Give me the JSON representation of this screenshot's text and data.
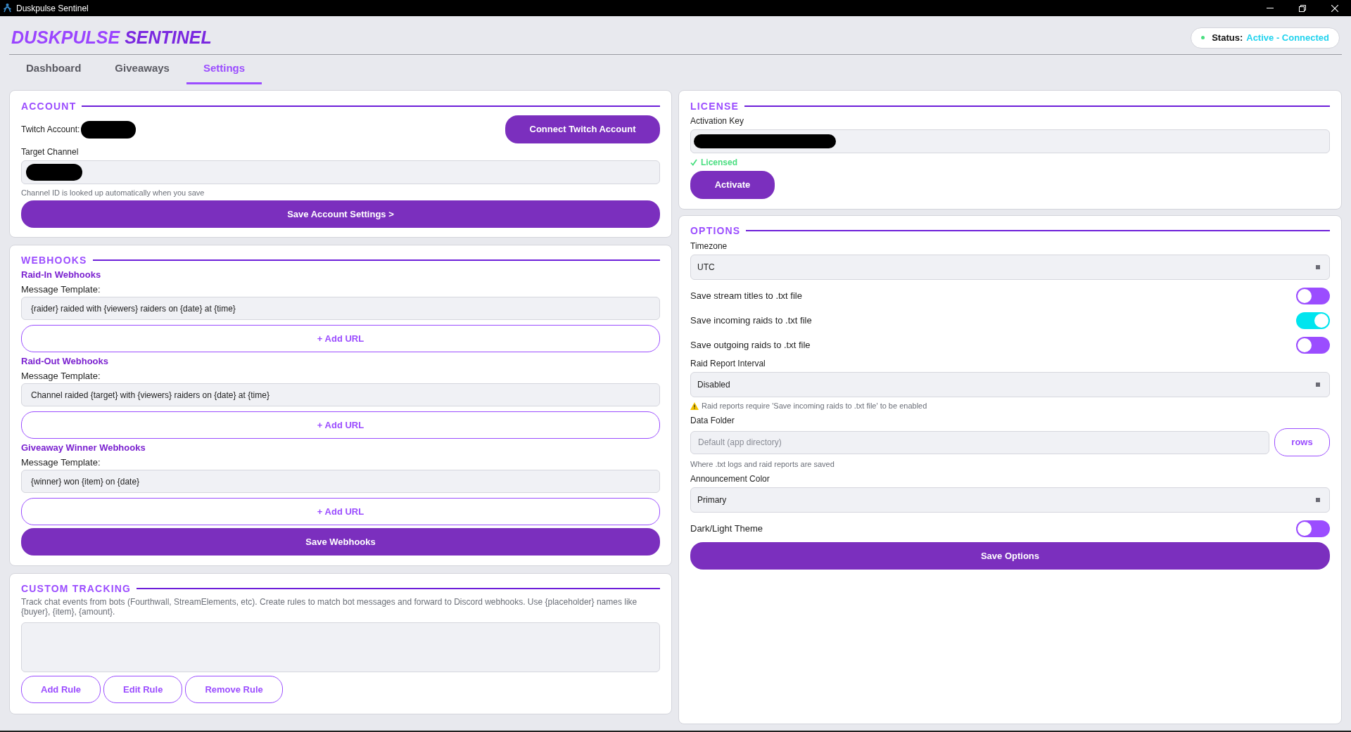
{
  "window": {
    "title": "Duskpulse Sentinel"
  },
  "brand": {
    "first": "DUSKPULSE",
    "second": "SENTINEL"
  },
  "status": {
    "label": "Status:",
    "value": "Active - Connected"
  },
  "tabs": [
    {
      "label": "Dashboard",
      "selected": false
    },
    {
      "label": "Giveaways",
      "selected": false
    },
    {
      "label": "Settings",
      "selected": true
    }
  ],
  "account": {
    "title": "ACCOUNT",
    "twitch_account_label": "Twitch Account:",
    "connect_button": "Connect Twitch Account",
    "target_channel_label": "Target Channel",
    "hint": "Channel ID is looked up automatically when you save",
    "save_button": "Save Account Settings >"
  },
  "webhooks": {
    "title": "WEBHOOKS",
    "groups": [
      {
        "title": "Raid-In Webhooks",
        "template_label": "Message Template:",
        "template": "{raider} raided with {viewers} raiders on {date} at {time}",
        "add_button": "+ Add URL"
      },
      {
        "title": "Raid-Out Webhooks",
        "template_label": "Message Template:",
        "template": "Channel raided {target} with {viewers} raiders on {date} at {time}",
        "add_button": "+ Add URL"
      },
      {
        "title": "Giveaway Winner Webhooks",
        "template_label": "Message Template:",
        "template": "{winner} won {item} on {date}",
        "add_button": "+ Add URL"
      }
    ],
    "save_button": "Save Webhooks"
  },
  "custom_tracking": {
    "title": "CUSTOM TRACKING",
    "description": "Track chat events from bots (Fourthwall, StreamElements, etc). Create rules to match bot messages and forward to Discord webhooks. Use {placeholder} names like {buyer}, {item}, {amount}.",
    "buttons": [
      "Add Rule",
      "Edit Rule",
      "Remove Rule"
    ]
  },
  "license": {
    "title": "LICENSE",
    "key_label": "Activation Key",
    "status_text": "Licensed",
    "activate_button": "Activate"
  },
  "options": {
    "title": "OPTIONS",
    "fields": [
      {
        "kind": "select",
        "label": "Timezone",
        "value": "UTC"
      },
      {
        "kind": "toggle",
        "label": "Save stream titles to .txt file",
        "on": false
      },
      {
        "kind": "toggle",
        "label": "Save incoming raids to .txt file",
        "on": true
      },
      {
        "kind": "toggle",
        "label": "Save outgoing raids to .txt file",
        "on": false
      },
      {
        "kind": "select",
        "label": "Raid Report Interval",
        "value": "Disabled",
        "warning": "Raid reports require 'Save incoming raids to .txt file' to be enabled"
      },
      {
        "kind": "folder",
        "label": "Data Folder",
        "placeholder": "Default (app directory)",
        "button": "rows",
        "hint": "Where .txt logs and raid reports are saved"
      },
      {
        "kind": "select",
        "label": "Announcement Color",
        "value": "Primary"
      },
      {
        "kind": "toggle",
        "label": "Dark/Light Theme",
        "on": false
      }
    ],
    "save_button": "Save Options"
  }
}
